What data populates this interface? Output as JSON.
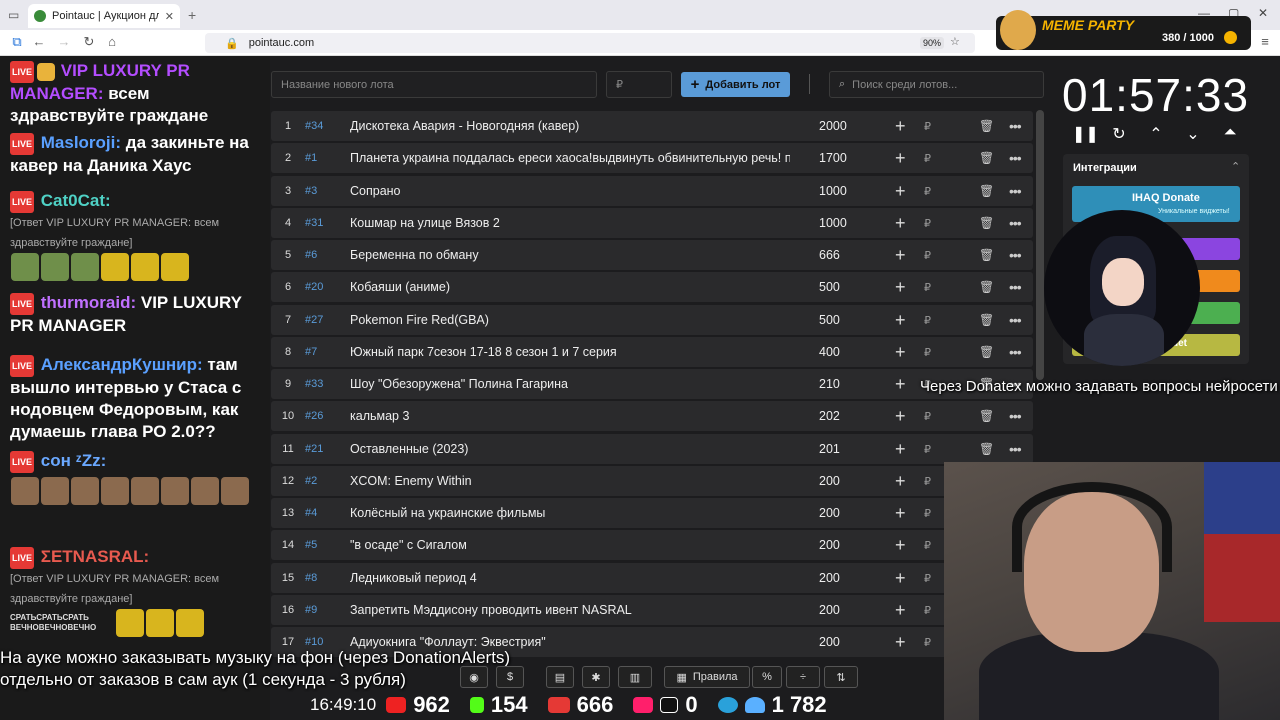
{
  "browser": {
    "tab_title": "Pointauc | Аукцион для стрим",
    "url": "pointauc.com",
    "zoom": "90%"
  },
  "meme_party": {
    "title": "MEME PARTY",
    "progress": "380 / 1000"
  },
  "chat": [
    {
      "nick": "VIP LUXURY PR MANAGER:",
      "text": "всем здравствуйте граждане",
      "nick_color": "#b44dff"
    },
    {
      "nick": "Masloroji:",
      "text": "да закиньте на кавер на Даника Хаус",
      "nick_color": "#5aa0ff"
    },
    {
      "nick": "Cat0Cat:",
      "text": "",
      "reply": "[Ответ VIP LUXURY PR MANAGER: всем здравствуйте граждане]",
      "nick_color": "#4fd1c5"
    },
    {
      "nick": "thurmoraid:",
      "text": "VIP LUXURY PR MANAGER",
      "nick_color": "#c070ff"
    },
    {
      "nick": "АлександрКушнир:",
      "text": "там вышло интервью у Стаса с нодовцем Федоровым, как думаешь глава РО 2.0??",
      "nick_color": "#5aa0ff"
    },
    {
      "nick": "сон ᶻZz:",
      "text": "",
      "nick_color": "#6aa8ff"
    },
    {
      "nick": "ΣETNASRAL:",
      "text": "",
      "reply": "[Ответ VIP LUXURY PR MANAGER: всем здравствуйте граждане]",
      "nick_color": "#e85a4f"
    },
    {
      "emote_text": "СРАТЬСРАТЬСРАТЬ ВЕЧНОВЕЧНОВЕЧНО"
    }
  ],
  "lot_form": {
    "name_placeholder": "Название нового лота",
    "amount_placeholder": "₽",
    "add_label": "Добавить лот",
    "search_placeholder": "Поиск среди лотов..."
  },
  "lots": [
    {
      "n": "1",
      "id": "#34",
      "name": "Дискотека Авария - Новогодняя (кавер)",
      "amount": "2000"
    },
    {
      "n": "2",
      "id": "#1",
      "name": "Планета украина поддалась ереси хаоса!выдвинуть обвинительную речь! по",
      "amount": "1700"
    },
    {
      "n": "3",
      "id": "#3",
      "name": "Сопрано",
      "amount": "1000"
    },
    {
      "n": "4",
      "id": "#31",
      "name": "Кошмар на улице Вязов 2",
      "amount": "1000"
    },
    {
      "n": "5",
      "id": "#6",
      "name": "Беременна по обману",
      "amount": "666"
    },
    {
      "n": "6",
      "id": "#20",
      "name": "Кобаяши (аниме)",
      "amount": "500"
    },
    {
      "n": "7",
      "id": "#27",
      "name": "Pokemon Fire Red(GBA)",
      "amount": "500"
    },
    {
      "n": "8",
      "id": "#7",
      "name": "Южный парк 7сезон 17-18 8 сезон 1 и 7 серия",
      "amount": "400"
    },
    {
      "n": "9",
      "id": "#33",
      "name": "Шоу \"Обезоружена\" Полина Гагарина",
      "amount": "210"
    },
    {
      "n": "10",
      "id": "#26",
      "name": "кальмар 3",
      "amount": "202"
    },
    {
      "n": "11",
      "id": "#21",
      "name": "Оставленные (2023)",
      "amount": "201"
    },
    {
      "n": "12",
      "id": "#2",
      "name": "XCOM: Enemy Within",
      "amount": "200"
    },
    {
      "n": "13",
      "id": "#4",
      "name": "Колёсный на украинские фильмы",
      "amount": "200"
    },
    {
      "n": "14",
      "id": "#5",
      "name": "\"в осаде\" с Сигалом",
      "amount": "200"
    },
    {
      "n": "15",
      "id": "#8",
      "name": "Ледниковый период 4",
      "amount": "200"
    },
    {
      "n": "16",
      "id": "#9",
      "name": "Запретить Мэддисону проводить ивент NASRAL",
      "amount": "200"
    },
    {
      "n": "17",
      "id": "#10",
      "name": "Адиуокнига \"Фоллаут: Эквестрия\"",
      "amount": "200"
    }
  ],
  "currency": "₽",
  "timer": "01:57:33",
  "integrations": {
    "title": "Интеграции",
    "donate": "IHAQ Donate",
    "donate_sub": "Уникальные виджеты!",
    "last": "uet"
  },
  "overlay": {
    "donatex": "Через Donatex можно задавать вопросы нейросети",
    "music_line1": "На ауке можно заказывать музыку на фон (через DonationAlerts)",
    "music_line2": "отдельно от заказов в сам аук (1 секунда - 3 рубля)"
  },
  "toolbar": {
    "rules": "Правила"
  },
  "stats": {
    "time": "16:49:10",
    "youtube": "962",
    "kick": "154",
    "live": "666",
    "rutube": "0",
    "viewers": "1 782"
  }
}
